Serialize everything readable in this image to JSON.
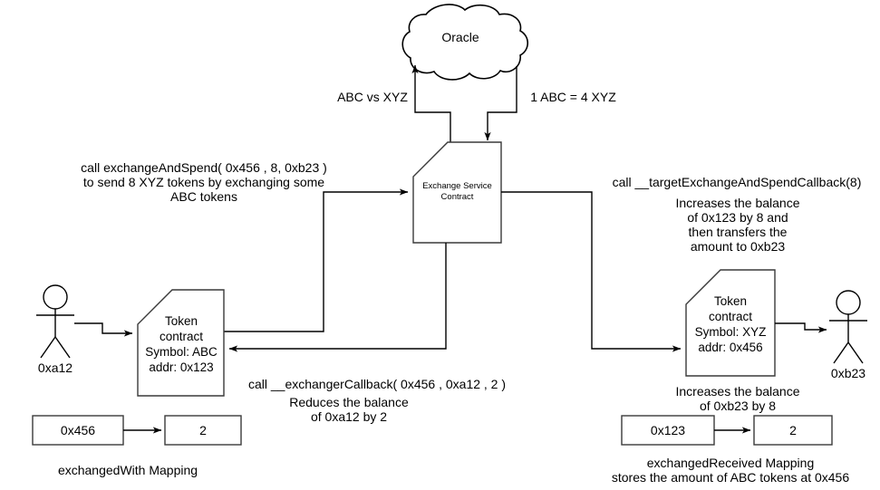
{
  "diagram": {
    "title_nodes": {
      "oracle": "Oracle",
      "exchange_service": "Exchange Service\nContract",
      "token_abc": "Token\ncontract\nSymbol: ABC\naddr: 0x123",
      "token_xyz": "Token\ncontract\nSymbol: XYZ\naddr: 0x456"
    },
    "actors": {
      "left": "0xa12",
      "right": "0xb23"
    },
    "edge_labels": {
      "oracle_request": "ABC vs XYZ",
      "oracle_response": "1 ABC = 4 XYZ",
      "user_call": "call exchangeAndSpend( 0x456 , 8, 0xb23 )\nto send 8 XYZ tokens by exchanging some\nABC tokens",
      "target_callback": "call __targetExchangeAndSpendCallback(8)",
      "target_callback_detail": "Increases the balance\nof 0x123 by 8 and\nthen transfers the\namount to 0xb23",
      "exchanger_callback": "call __exchangerCallback( 0x456 , 0xa12 , 2 )",
      "exchanger_callback_detail": "Reduces the balance\nof 0xa12 by 2",
      "increase_b23": "Increases the balance\nof 0xb23 by 8"
    },
    "mappings": {
      "left": {
        "key": "0x456",
        "value": "2",
        "caption": "exchangedWith Mapping"
      },
      "right": {
        "key": "0x123",
        "value": "2",
        "caption": "exchangedReceived Mapping\nstores the amount of ABC tokens at 0x456"
      }
    },
    "colors": {
      "stroke": "#000000",
      "box_stroke": "#3a3a3a",
      "fill": "#ffffff",
      "text": "#000000"
    }
  }
}
